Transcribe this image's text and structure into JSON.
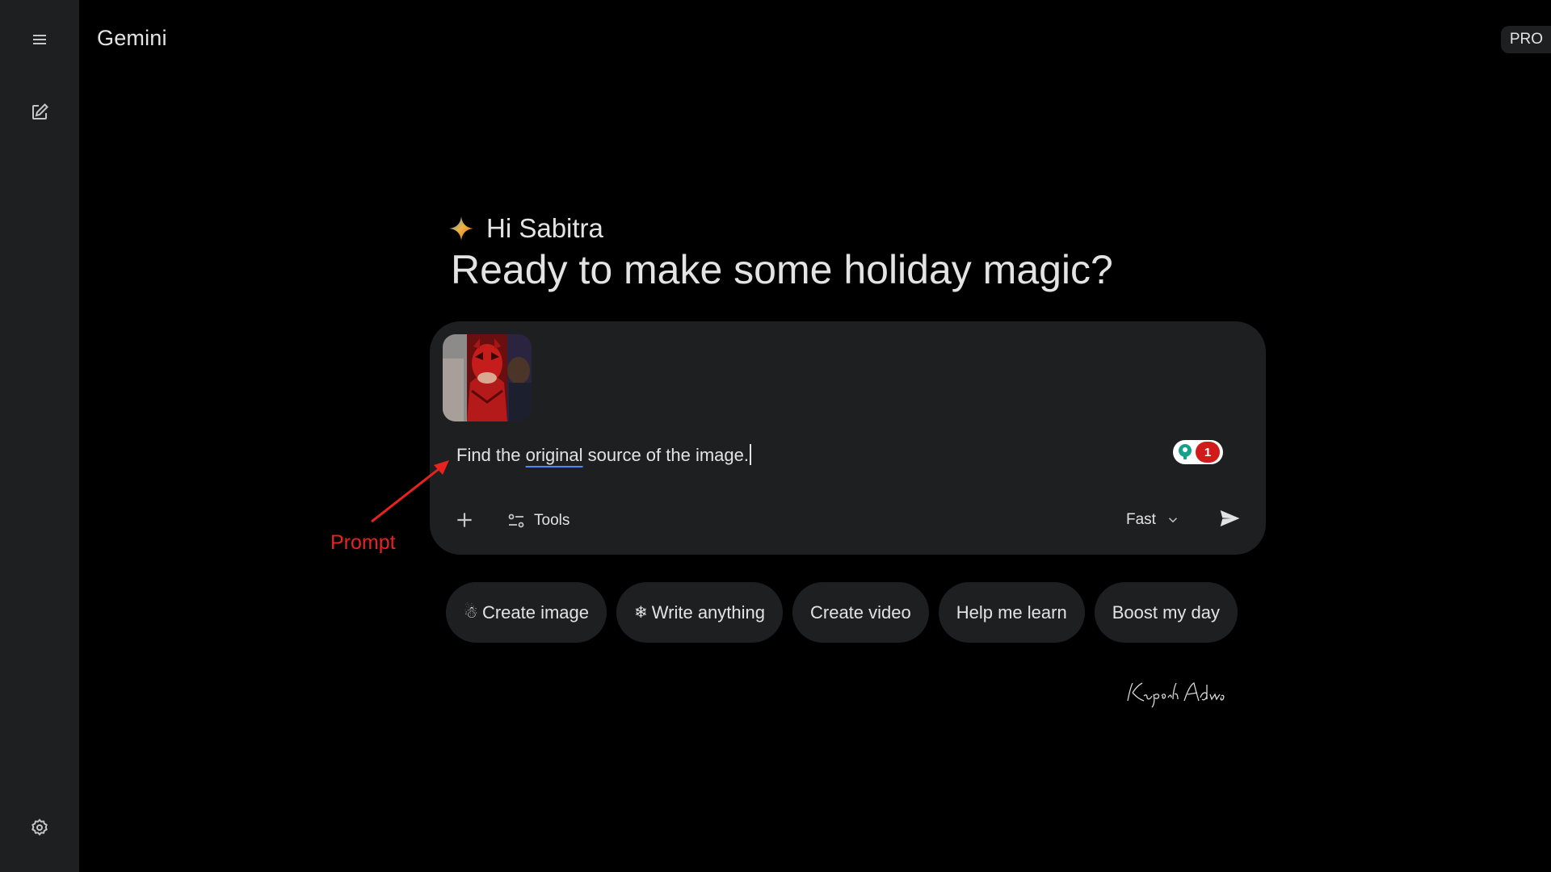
{
  "header": {
    "app_title": "Gemini",
    "plan_badge": "PRO"
  },
  "sidebar": {
    "menu_icon": "menu-icon",
    "new_chat_icon": "edit-icon",
    "settings_icon": "gear-icon"
  },
  "main": {
    "greeting": "Hi Sabitra",
    "headline": "Ready to make some holiday magic?"
  },
  "composer": {
    "prompt_before": "Find the ",
    "prompt_underlined": "original",
    "prompt_after": " source of the image.",
    "extension_count": "1",
    "tools_label": "Tools",
    "model_label": "Fast"
  },
  "chips": [
    {
      "icon": "☃",
      "label": "Create image"
    },
    {
      "icon": "❄",
      "label": "Write anything"
    },
    {
      "label": "Create video"
    },
    {
      "label": "Help me learn"
    },
    {
      "label": "Boost my day"
    }
  ],
  "annotation": {
    "label": "Prompt",
    "color": "#e8231f"
  },
  "signature": "Kripesh Adwani",
  "colors": {
    "background": "#000000",
    "surface": "#1e1f20",
    "text": "#e3e3e3",
    "accent_underline": "#4a8af4"
  }
}
